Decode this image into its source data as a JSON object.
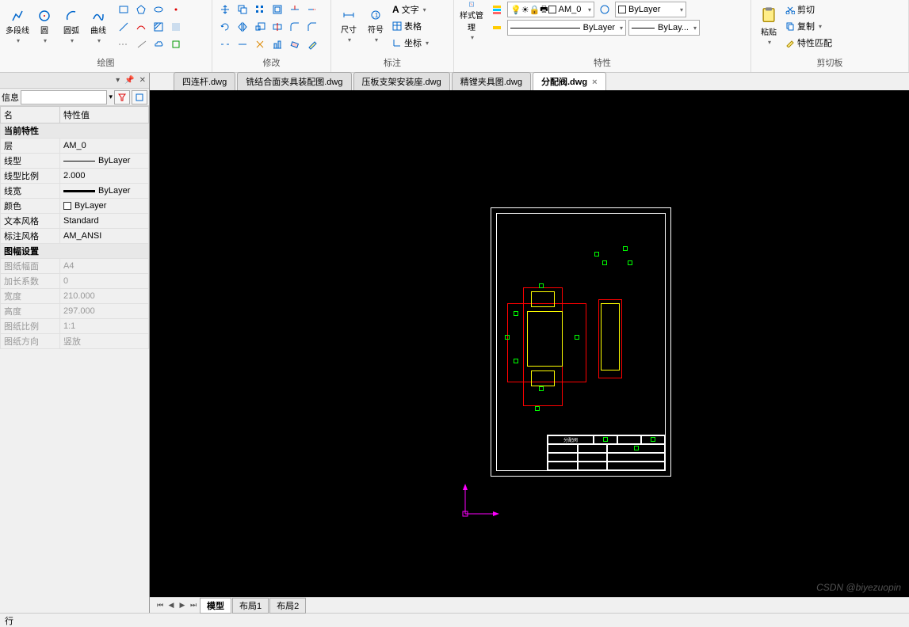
{
  "ribbon": {
    "draw": {
      "title": "绘图",
      "polyline": "多段线",
      "circle": "圆",
      "arc": "圆弧",
      "curve": "曲线"
    },
    "modify": {
      "title": "修改"
    },
    "annotate": {
      "title": "标注",
      "dim": "尺寸",
      "symbol": "符号",
      "text": "文字",
      "table": "表格",
      "coord": "坐标"
    },
    "style": {
      "title": "特性",
      "manager": "样式管理"
    },
    "layer_combo": "AM_0",
    "color_combo": "ByLayer",
    "linetype_combo": "ByLayer",
    "lineweight_combo": "ByLay...",
    "clipboard": {
      "title": "剪切板",
      "paste": "粘贴",
      "cut": "剪切",
      "copy": "复制",
      "match": "特性匹配"
    }
  },
  "docTabs": [
    {
      "label": "四连杆.dwg",
      "active": false
    },
    {
      "label": "铣结合面夹具装配图.dwg",
      "active": false
    },
    {
      "label": "压板支架安装座.dwg",
      "active": false
    },
    {
      "label": "精镗夹具图.dwg",
      "active": false
    },
    {
      "label": "分配阀.dwg",
      "active": true
    }
  ],
  "propPanel": {
    "infoLabel": "信息",
    "headers": {
      "name": "名",
      "value": "特性值"
    },
    "section_current": "当前特性",
    "rows_current": [
      {
        "k": "层",
        "v": "AM_0"
      },
      {
        "k": "线型",
        "v": "ByLayer",
        "lt": "thin"
      },
      {
        "k": "线型比例",
        "v": "2.000"
      },
      {
        "k": "线宽",
        "v": "ByLayer",
        "lt": "thick"
      },
      {
        "k": "颜色",
        "v": "ByLayer",
        "sw": true
      },
      {
        "k": "文本风格",
        "v": "Standard"
      },
      {
        "k": "标注风格",
        "v": "AM_ANSI"
      }
    ],
    "section_sheet": "图幅设置",
    "rows_sheet": [
      {
        "k": "图纸幅面",
        "v": "A4"
      },
      {
        "k": "加长系数",
        "v": "0"
      },
      {
        "k": "宽度",
        "v": "210.000"
      },
      {
        "k": "高度",
        "v": "297.000"
      },
      {
        "k": "图纸比例",
        "v": "1:1"
      },
      {
        "k": "图纸方向",
        "v": "竖放"
      }
    ]
  },
  "drawing": {
    "title_text": "分配阀"
  },
  "layoutTabs": {
    "model": "模型",
    "layout1": "布局1",
    "layout2": "布局2"
  },
  "statusBar": "行",
  "watermark": "CSDN @biyezuopin"
}
